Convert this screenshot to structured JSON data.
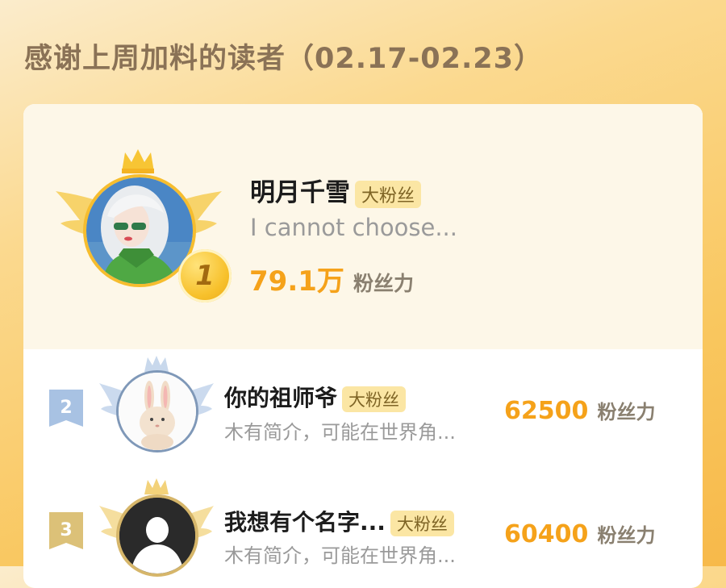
{
  "page": {
    "title": "感谢上周加料的读者（02.17-02.23）"
  },
  "colors": {
    "accent": "#f5a21a",
    "tag_bg": "#fbe6a4",
    "card_top_bg": "#fdf7e8"
  },
  "readers": [
    {
      "rank": "1",
      "name": "明月千雪",
      "tag": "大粉丝",
      "intro": "I cannot choose...",
      "power_value": "79.1万",
      "power_unit": "粉丝力",
      "avatar_icon": "anime-girl-avatar"
    },
    {
      "rank": "2",
      "name": "你的祖师爷",
      "tag": "大粉丝",
      "intro": "木有简介，可能在世界角...",
      "power_value": "62500",
      "power_unit": "粉丝力",
      "avatar_icon": "rabbit-avatar"
    },
    {
      "rank": "3",
      "name": "我想有个名字...",
      "tag": "大粉丝",
      "intro": "木有简介，可能在世界角...",
      "power_value": "60400",
      "power_unit": "粉丝力",
      "avatar_icon": "default-avatar"
    }
  ]
}
